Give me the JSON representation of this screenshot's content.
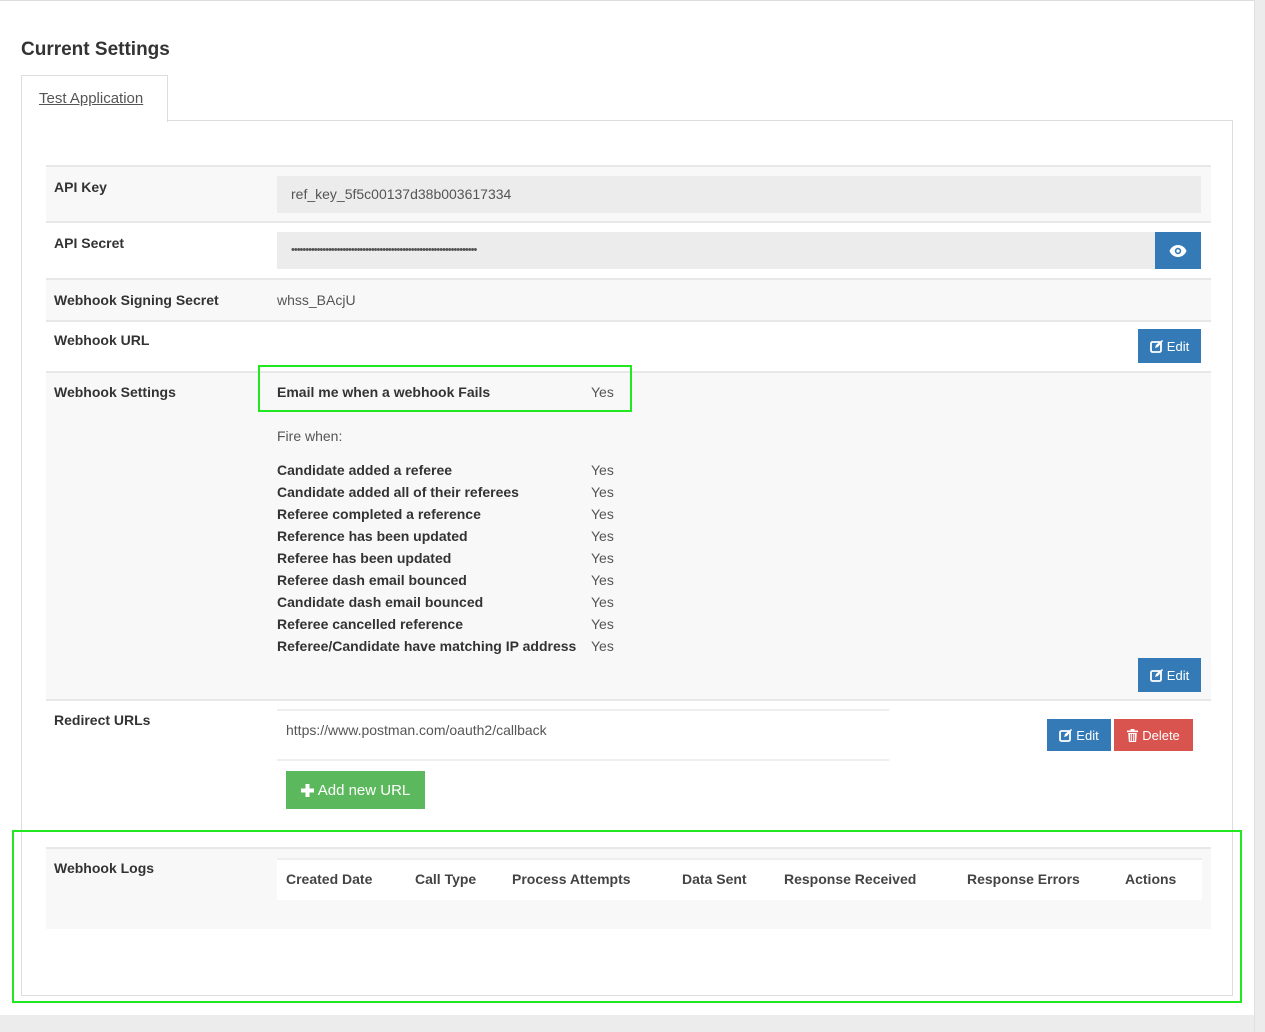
{
  "page": {
    "title": "Current Settings"
  },
  "tabs": [
    {
      "label": "Test Application",
      "active": true
    }
  ],
  "settings": {
    "api_key": {
      "label": "API Key",
      "value": "ref_key_5f5c00137d38b003617334"
    },
    "api_secret": {
      "label": "API Secret",
      "value": "•••••••••••••••••••••••••••••••••••••••••••••••••••••••••••••••••",
      "reveal_icon": "eye-icon"
    },
    "signing_secret": {
      "label": "Webhook Signing Secret",
      "value": "whss_BAcjU"
    },
    "webhook_url": {
      "label": "Webhook URL",
      "value": "",
      "edit_label": "Edit",
      "edit_icon": "edit-icon"
    },
    "webhook_settings": {
      "label": "Webhook Settings",
      "email_on_fail": {
        "label": "Email me when a webhook Fails",
        "value": "Yes"
      },
      "fire_when_label": "Fire when:",
      "events": [
        {
          "label": "Candidate added a referee",
          "value": "Yes"
        },
        {
          "label": "Candidate added all of their referees",
          "value": "Yes"
        },
        {
          "label": "Referee completed a reference",
          "value": "Yes"
        },
        {
          "label": "Reference has been updated",
          "value": "Yes"
        },
        {
          "label": "Referee has been updated",
          "value": "Yes"
        },
        {
          "label": "Referee dash email bounced",
          "value": "Yes"
        },
        {
          "label": "Candidate dash email bounced",
          "value": "Yes"
        },
        {
          "label": "Referee cancelled reference",
          "value": "Yes"
        },
        {
          "label": "Referee/Candidate have matching IP address",
          "value": "Yes"
        }
      ],
      "edit_label": "Edit"
    },
    "redirect_urls": {
      "label": "Redirect URLs",
      "urls": [
        "https://www.postman.com/oauth2/callback"
      ],
      "edit_label": "Edit",
      "delete_label": "Delete",
      "add_label": "Add new URL"
    },
    "webhook_logs": {
      "label": "Webhook Logs",
      "columns": [
        "Created Date",
        "Call Type",
        "Process Attempts",
        "Data Sent",
        "Response Received",
        "Response Errors",
        "Actions"
      ],
      "rows": []
    }
  },
  "colors": {
    "primary": "#337ab7",
    "danger": "#d9534f",
    "success": "#5cb85c",
    "highlight": "#22e822"
  }
}
